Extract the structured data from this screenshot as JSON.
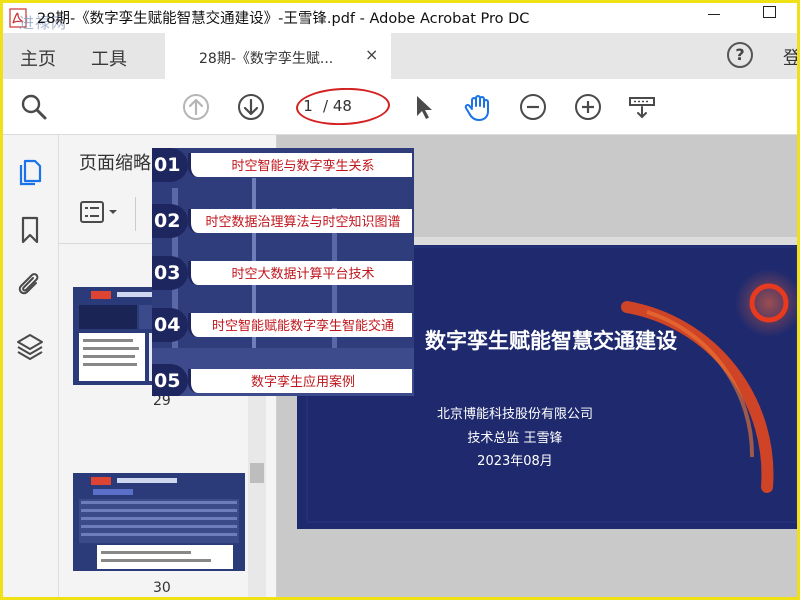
{
  "window": {
    "title": "28期-《数字孪生赋能智慧交通建设》-王雪锋.pdf - Adobe Acrobat Pro DC",
    "watermark": "进禄网"
  },
  "tabs": {
    "home": "主页",
    "tools": "工具",
    "document": "28期-《数字孪生赋...",
    "close": "×",
    "help": "?",
    "signin": "登"
  },
  "toolbar": {
    "current_page": "1",
    "total_pages": "/ 48"
  },
  "panel": {
    "title": "页面缩略图",
    "thumbnails": [
      {
        "page": "29"
      },
      {
        "page": "30"
      }
    ]
  },
  "slide": {
    "title": "数字孪生赋能智慧交通建设",
    "company": "北京博能科技股份有限公司",
    "author": "技术总监 王雪锋",
    "date": "2023年08月"
  },
  "overlay": {
    "items": [
      {
        "num": "01",
        "label": "时空智能与数字孪生关系"
      },
      {
        "num": "02",
        "label": "时空数据治理算法与时空知识图谱"
      },
      {
        "num": "03",
        "label": "时空大数据计算平台技术"
      },
      {
        "num": "04",
        "label": "时空智能赋能数字孪生智能交通"
      },
      {
        "num": "05",
        "label": "数字孪生应用案例"
      }
    ]
  },
  "colors": {
    "frame": "#f0e016",
    "accent_blue": "#1a73e8",
    "annotation_red": "#d42020",
    "slide_bg": "#1f2a6e",
    "overlay_label": "#c0151c"
  }
}
